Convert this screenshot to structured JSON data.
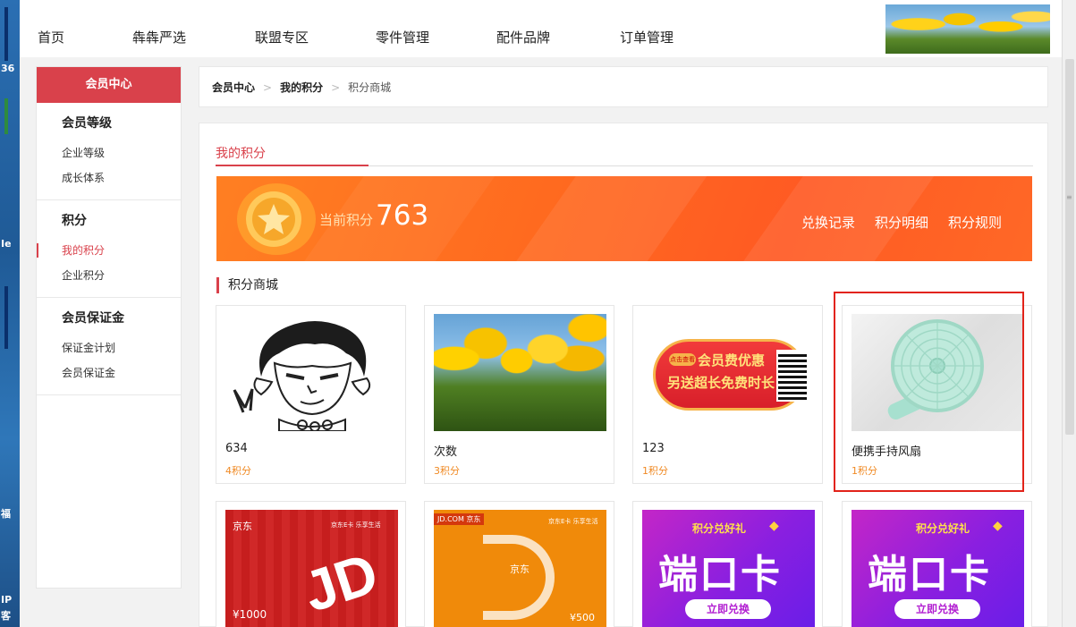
{
  "nav": {
    "items": [
      "首页",
      "犇犇严选",
      "联盟专区",
      "零件管理",
      "配件品牌",
      "订单管理"
    ]
  },
  "sidebar": {
    "header": "会员中心",
    "groups": [
      {
        "title": "会员等级",
        "items": [
          "企业等级",
          "成长体系"
        ]
      },
      {
        "title": "积分",
        "items": [
          "我的积分",
          "企业积分"
        ]
      },
      {
        "title": "会员保证金",
        "items": [
          "保证金计划",
          "会员保证金"
        ]
      }
    ],
    "active_item": "我的积分"
  },
  "breadcrumb": {
    "items": [
      "会员中心",
      "我的积分",
      "积分商城"
    ]
  },
  "points": {
    "tab": "我的积分",
    "label": "当前积分",
    "value": "763",
    "links": [
      "兑换记录",
      "积分明细",
      "积分规则"
    ]
  },
  "mall": {
    "title": "积分商城",
    "products": [
      {
        "name": "634",
        "price": "4积分"
      },
      {
        "name": "次数",
        "price": "3积分"
      },
      {
        "name": "123",
        "price": "1积分"
      },
      {
        "name": "便携手持风扇",
        "price": "1积分"
      }
    ],
    "image_text": {
      "coupon_tag": "点击查看",
      "coupon_line1": "会员费优惠",
      "coupon_line2": "另送超长免费时长",
      "jd_red_brand": "京东",
      "jd_red_corner": "京东E卡 乐享生活",
      "jd_red_letters": "JD",
      "jd_red_amount": "¥1000",
      "jd_orange_brand": "JD.COM 京东",
      "jd_orange_corner": "京东E卡 乐享生活",
      "jd_orange_center": "京东",
      "jd_orange_amount": "¥500",
      "purple_top": "积分兑好礼",
      "purple_main": "端口卡",
      "purple_button": "立即兑换"
    }
  },
  "colors": {
    "accent": "#d9414b",
    "price": "#f08a24",
    "banner": "#ff6a1f",
    "highlight": "#e2231a"
  }
}
